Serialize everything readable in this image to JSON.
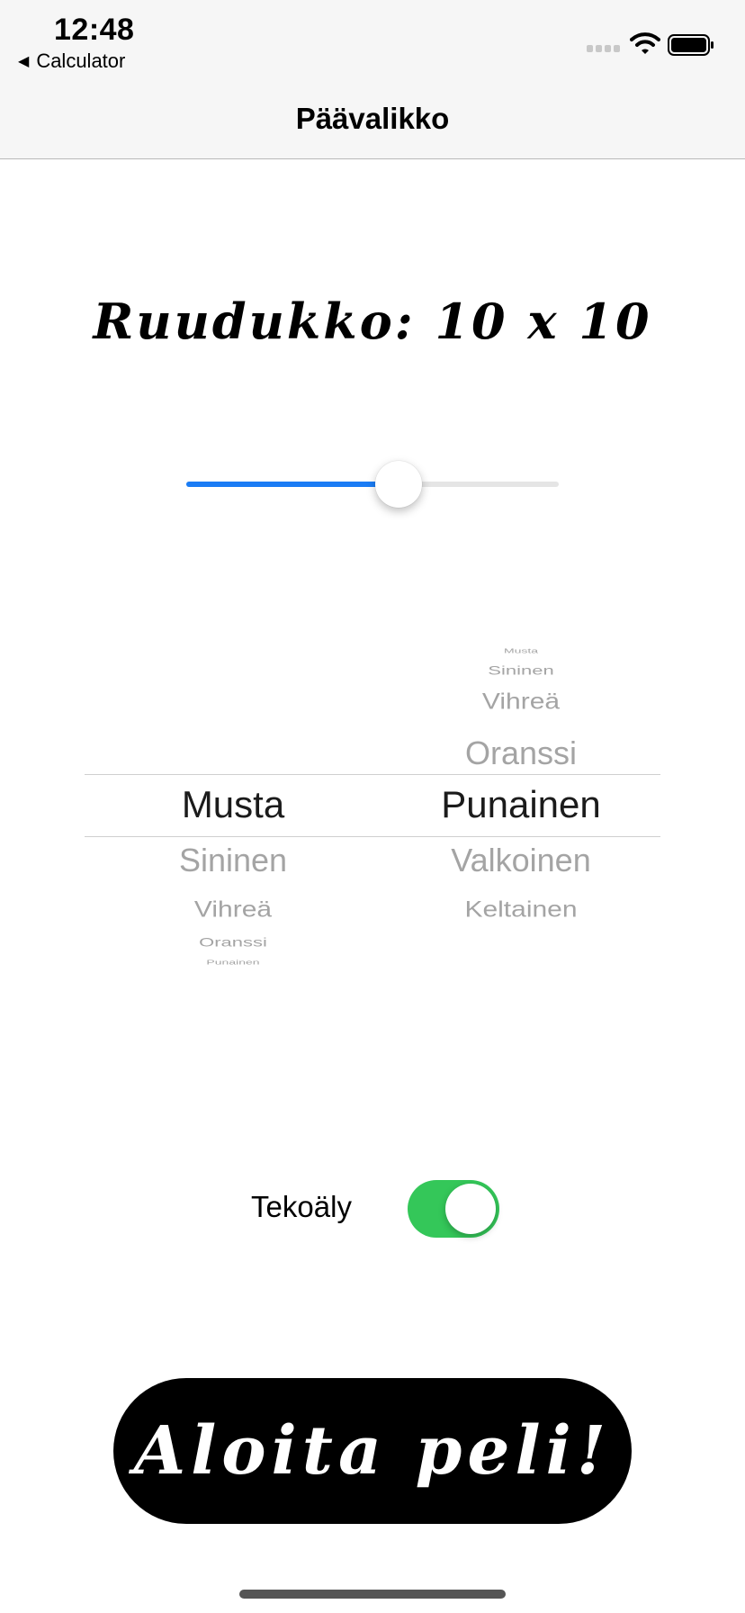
{
  "status_bar": {
    "time": "12:48",
    "back_app": "Calculator"
  },
  "nav": {
    "title": "Päävalikko"
  },
  "grid": {
    "heading": "Ruudukko: 10 x 10",
    "slider_fraction": 0.57
  },
  "picker": {
    "left_column": {
      "selected": "Musta",
      "above": [],
      "below": [
        "Sininen",
        "Vihreä",
        "Oranssi",
        "Punainen"
      ]
    },
    "right_column": {
      "selected": "Punainen",
      "above": [
        "Musta",
        "Sininen",
        "Vihreä",
        "Oranssi"
      ],
      "below": [
        "Valkoinen",
        "Keltainen"
      ]
    }
  },
  "ai": {
    "label": "Tekoäly",
    "enabled": true
  },
  "start_button": {
    "label": "Aloita peli!"
  },
  "colors": {
    "accent": "#1a7cf5",
    "toggle_on": "#34c759",
    "button_bg": "#000000"
  }
}
